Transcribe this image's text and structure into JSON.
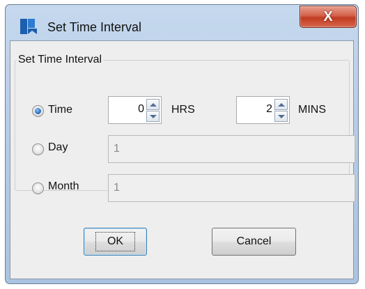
{
  "window": {
    "title": "Set Time Interval",
    "close_icon": "close-x",
    "close_glyph": "X"
  },
  "group": {
    "legend": "Set Time Interval"
  },
  "options": {
    "time": {
      "label": "Time",
      "selected": true,
      "hours_value": "0",
      "hours_unit": "HRS",
      "mins_value": "2",
      "mins_unit": "MINS"
    },
    "day": {
      "label": "Day",
      "selected": false,
      "value": "1"
    },
    "month": {
      "label": "Month",
      "selected": false,
      "value": "1"
    }
  },
  "buttons": {
    "ok_label": "OK",
    "cancel_label": "Cancel"
  },
  "colors": {
    "title_bar": "#b7cde6",
    "close_button": "#c23b22",
    "dialog_background": "#eeeeee"
  }
}
